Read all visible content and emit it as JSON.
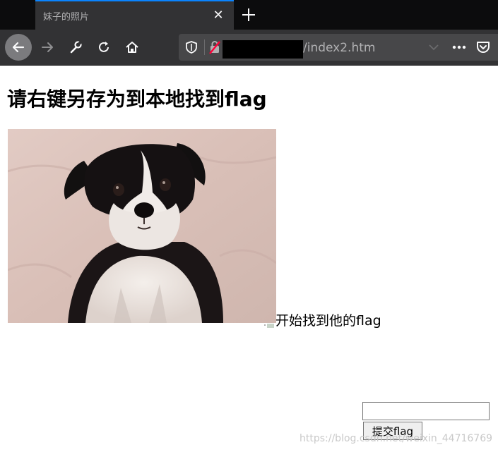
{
  "browser": {
    "tab_title": "妹子的照片",
    "tab_close": "✕",
    "url_visible": "/index2.htm",
    "icons": [
      "back-icon",
      "forward-icon",
      "wrench-icon",
      "reload-icon",
      "home-icon",
      "shield-icon",
      "insecure-lock-icon",
      "chevron-down-icon",
      "more-icon",
      "pocket-icon",
      "new-tab-icon"
    ],
    "colors": {
      "tab_accent": "#0a84ff",
      "chrome_bg": "#323234",
      "tabbar_bg": "#0c0c0d"
    }
  },
  "page": {
    "heading": "请右键另存为到本地找到flag",
    "inline_text": "开始找到他的flag",
    "input_value": "",
    "submit_label": "提交flag",
    "watermark": "https://blog.csdn.net/weixin_44716769"
  }
}
